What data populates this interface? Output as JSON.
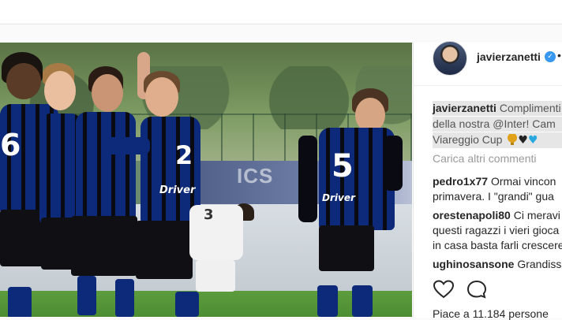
{
  "post": {
    "username": "javierzanetti",
    "verified_mark": "✓",
    "more_menu": "•",
    "caption": {
      "line1_user": "javierzanetti",
      "line1_text": "Complimenti",
      "line2_text": "della nostra @Inter! Cam",
      "line3_text": "Viareggio Cup"
    },
    "caption_emojis": [
      "trophy-icon",
      "black-heart-icon",
      "blue-heart-icon"
    ],
    "load_more_comments": "Carica altri commenti",
    "comments": [
      {
        "user": "pedro1x77",
        "lines": [
          "Ormai vincon",
          "primavera. I \"grandi\" gua"
        ]
      },
      {
        "user": "orestenapoli80",
        "lines": [
          "Ci meravi",
          "questi ragazzi i vieri gioca",
          "in casa basta farli crescere"
        ]
      },
      {
        "user": "ughinosansone",
        "lines": [
          "Grandiss"
        ]
      }
    ],
    "likes": "Piace a 11.184 persone"
  },
  "photo": {
    "banner_text": "ICS",
    "player_numbers": [
      "6",
      "2",
      "5",
      "3"
    ],
    "sponsor": "Driver"
  },
  "colors": {
    "accent_blue": "#3897f0",
    "inter_blue": "#0d2a7a",
    "muted_text": "#999999"
  }
}
